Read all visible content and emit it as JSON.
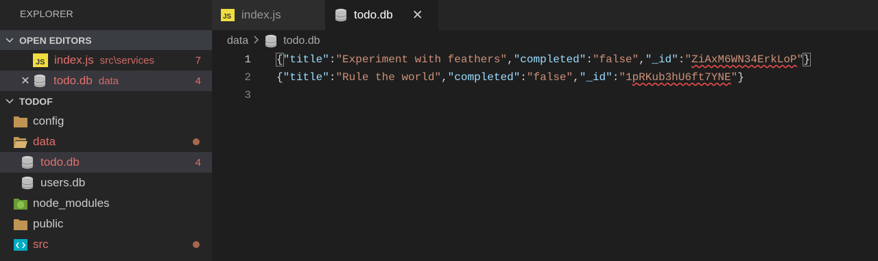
{
  "explorer": {
    "title": "EXPLORER",
    "open_editors_label": "OPEN EDITORS",
    "open_editors": [
      {
        "name": "index.js",
        "desc": "src\\services",
        "count": "7",
        "icon": "js-file-icon"
      },
      {
        "name": "todo.db",
        "desc": "data",
        "count": "4",
        "icon": "database-icon"
      }
    ],
    "project_label": "TODOF",
    "tree": {
      "config": "config",
      "data": "data",
      "todo_db": "todo.db",
      "todo_db_count": "4",
      "users_db": "users.db",
      "node_modules": "node_modules",
      "public": "public",
      "src": "src"
    }
  },
  "tabs": [
    {
      "label": "index.js",
      "icon": "js-file-icon",
      "active": false
    },
    {
      "label": "todo.db",
      "icon": "database-icon",
      "active": true,
      "close": "✕"
    }
  ],
  "breadcrumb": {
    "folder": "data",
    "file": "todo.db"
  },
  "editor": {
    "line_numbers": [
      "1",
      "2",
      "3"
    ],
    "lines": [
      {
        "key_title": "\"title\"",
        "val_title": "\"Experiment with feathers\"",
        "key_completed": "\"completed\"",
        "val_completed": "\"false\"",
        "key_id": "\"_id\"",
        "val_id_pre": "\"",
        "val_id_sq": "ZiAxM6WN34ErkLoP",
        "val_id_post": "\""
      },
      {
        "key_title": "\"title\"",
        "val_title": "\"Rule the world\"",
        "key_completed": "\"completed\"",
        "val_completed": "\"false\"",
        "key_id": "\"_id\"",
        "val_id_pre": "\"1",
        "val_id_sq": "pRKub3hU6ft7YNE",
        "val_id_post": "\""
      }
    ]
  },
  "colors": {
    "modified": "#e2706c",
    "js_badge": "#f1dd3f",
    "folder": "#c09553",
    "node_modules": "#8bc34a",
    "src_folder": "#00acc1"
  }
}
